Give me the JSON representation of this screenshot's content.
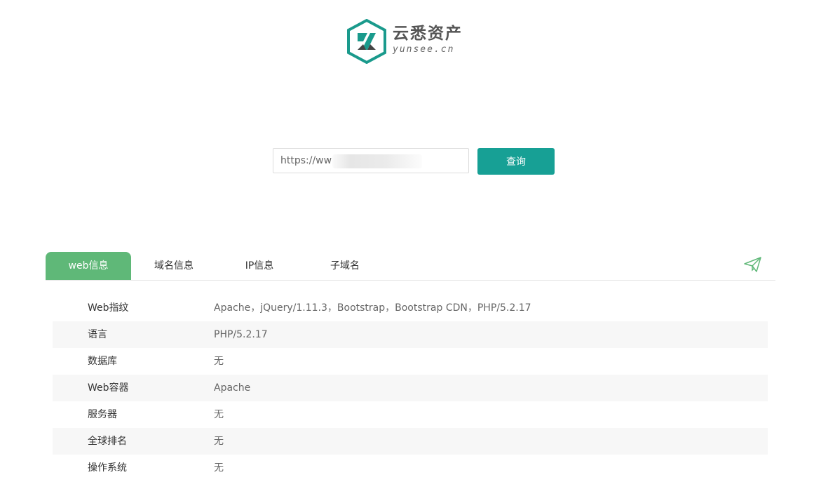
{
  "logo": {
    "cn": "云悉资产",
    "en": "yunsee.cn",
    "colors": {
      "primary": "#1a9a8c",
      "dark": "#444444"
    }
  },
  "search": {
    "value": "https://ww",
    "button_label": "查询"
  },
  "tabs": [
    {
      "label": "web信息",
      "active": true
    },
    {
      "label": "域名信息",
      "active": false
    },
    {
      "label": "IP信息",
      "active": false
    },
    {
      "label": "子域名",
      "active": false
    }
  ],
  "send_icon": "paper-plane-icon",
  "info": [
    {
      "label": "Web指纹",
      "value": "Apache，jQuery/1.11.3，Bootstrap，Bootstrap CDN，PHP/5.2.17"
    },
    {
      "label": "语言",
      "value": "PHP/5.2.17"
    },
    {
      "label": "数据库",
      "value": "无"
    },
    {
      "label": "Web容器",
      "value": "Apache"
    },
    {
      "label": "服务器",
      "value": "无"
    },
    {
      "label": "全球排名",
      "value": "无"
    },
    {
      "label": "操作系统",
      "value": "无"
    }
  ],
  "colors": {
    "accent": "#17a095",
    "tab_active": "#5fb878"
  }
}
